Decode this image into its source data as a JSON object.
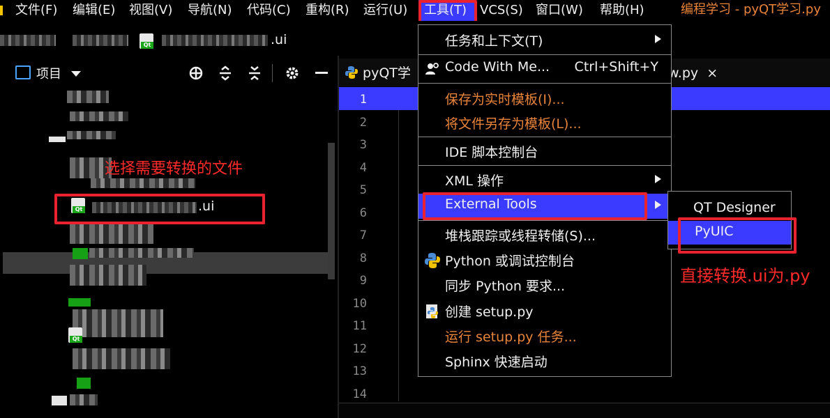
{
  "menubar": {
    "items": [
      {
        "label": "文件(F)"
      },
      {
        "label": "编辑(E)"
      },
      {
        "label": "视图(V)"
      },
      {
        "label": "导航(N)"
      },
      {
        "label": "代码(C)"
      },
      {
        "label": "重构(R)"
      },
      {
        "label": "运行(U)"
      },
      {
        "label": "工具(T)"
      },
      {
        "label": "VCS(S)"
      },
      {
        "label": "窗口(W)"
      },
      {
        "label": "帮助(H)"
      }
    ],
    "window_title": "编程学习 - pyQT学习.py"
  },
  "breadcrumb": {
    "file_suffix": ".ui"
  },
  "project_panel": {
    "title": "项目",
    "selected_file_suffix": ".ui"
  },
  "annotations": {
    "select_file": "选择需要转换的文件",
    "convert": "直接转换.ui为.py"
  },
  "editor": {
    "tabs": [
      {
        "label": "pyQT学"
      },
      {
        "label": "w.py"
      }
    ],
    "close_glyph": "×",
    "line_numbers": [
      "1",
      "2",
      "3",
      "4",
      "5",
      "6",
      "7",
      "8",
      "9",
      "10",
      "11",
      "12",
      "13",
      "14"
    ]
  },
  "tools_menu": {
    "items": [
      {
        "label": "任务和上下文(T)",
        "submenu": true
      },
      {
        "label": "Code With Me...",
        "shortcut": "Ctrl+Shift+Y"
      },
      {
        "label": "保存为实时模板(I)...",
        "disabled": true
      },
      {
        "label": "将文件另存为模板(L)...",
        "disabled": true
      },
      {
        "label": "IDE 脚本控制台"
      },
      {
        "label": "XML 操作",
        "submenu": true
      },
      {
        "label": "External Tools",
        "submenu": true,
        "highlighted": true
      },
      {
        "label": "堆栈跟踪或线程转储(S)..."
      },
      {
        "label": "Python 或调试控制台"
      },
      {
        "label": "同步 Python 要求..."
      },
      {
        "label": "创建 setup.py"
      },
      {
        "label": "运行 setup.py 任务...",
        "disabled": true
      },
      {
        "label": "Sphinx 快速启动"
      }
    ]
  },
  "external_tools_submenu": {
    "items": [
      {
        "label": "QT Designer"
      },
      {
        "label": "PyUIC",
        "highlighted": true
      }
    ]
  },
  "colors": {
    "highlight": "#3b3bff",
    "annotation_red": "#e8222e",
    "disabled_orange": "#e8843a"
  }
}
